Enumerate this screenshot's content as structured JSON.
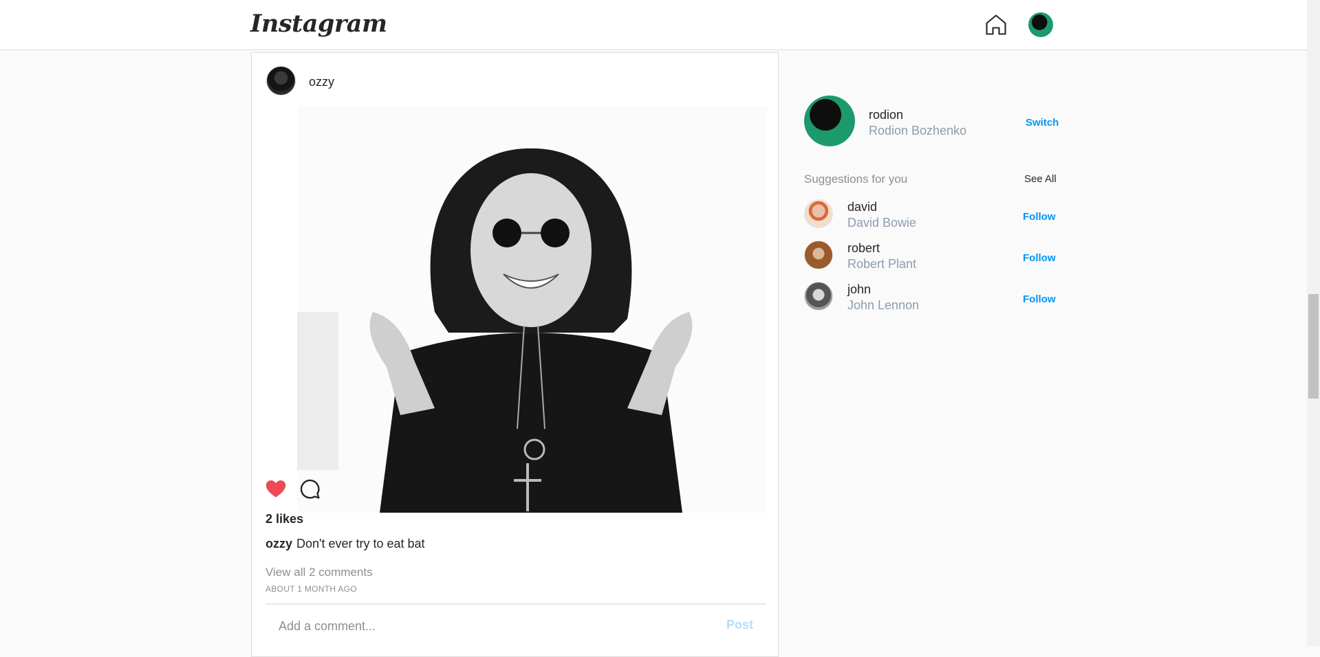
{
  "header": {
    "logo": "Instagram",
    "home_icon": "home-icon",
    "avatar": "user-avatar"
  },
  "post": {
    "username": "ozzy",
    "likes": "2 likes",
    "caption_user": "ozzy",
    "caption_text": "Don't ever try to eat bat",
    "view_comments": "View all 2 comments",
    "timestamp": "ABOUT 1 MONTH AGO",
    "comment_placeholder": "Add a comment...",
    "post_button": "Post",
    "heart_color": "#ed4956"
  },
  "sidebar": {
    "me": {
      "username": "rodion",
      "fullname": "Rodion Bozhenko",
      "switch_label": "Switch"
    },
    "suggestions_title": "Suggestions for you",
    "see_all": "See All",
    "suggestions": [
      {
        "username": "david",
        "fullname": "David Bowie",
        "follow": "Follow"
      },
      {
        "username": "robert",
        "fullname": "Robert Plant",
        "follow": "Follow"
      },
      {
        "username": "john",
        "fullname": "John Lennon",
        "follow": "Follow"
      }
    ]
  },
  "colors": {
    "accent": "#0095f6",
    "like": "#ed4956",
    "border": "#dbdbdb",
    "avatar_green": "#1c9a6c"
  }
}
